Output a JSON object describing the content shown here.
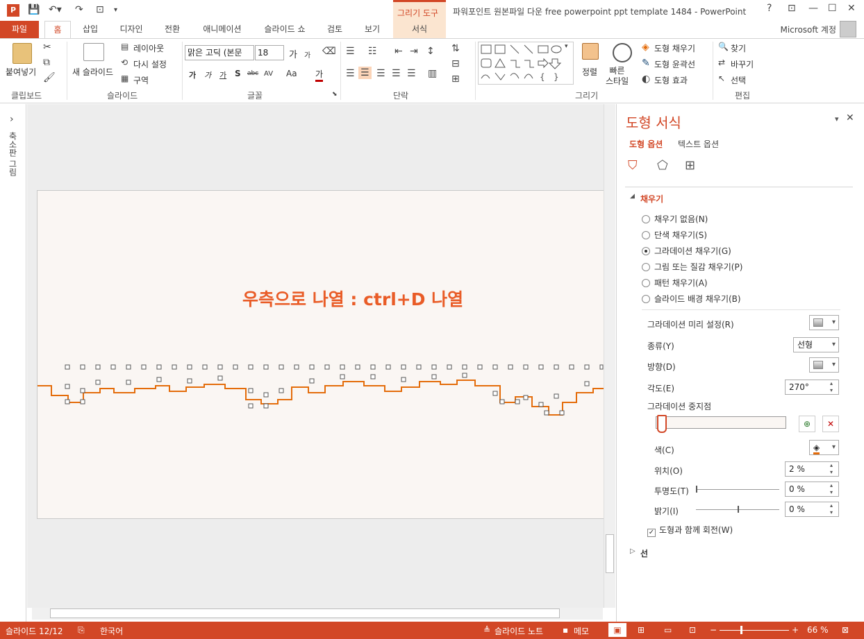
{
  "window": {
    "title": "파워포인트 원본파일 다운 free powerpoint ppt template 1484 - PowerPoint",
    "context_tab": "그리기 도구",
    "account": "Microsoft 계정",
    "help": "?",
    "min": "—",
    "max": "☐",
    "close": "✕"
  },
  "tabs": [
    "파일",
    "홈",
    "삽입",
    "디자인",
    "전환",
    "애니메이션",
    "슬라이드 쇼",
    "검토",
    "보기",
    "서식"
  ],
  "ribbon": {
    "clipboard": {
      "label": "클립보드",
      "paste": "붙여넣기"
    },
    "slides": {
      "label": "슬라이드",
      "new_slide": "새 슬라이드",
      "layout": "레이아웃",
      "reset": "다시 설정",
      "section": "구역"
    },
    "font": {
      "label": "글꼴",
      "font_name": "맑은 고딕 (본문",
      "font_size": "18",
      "grow": "가",
      "shrink": "가",
      "bold": "가",
      "italic": "가",
      "underline": "가",
      "shadow": "S",
      "strike": "abc",
      "spacing": "AV",
      "case": "Aa",
      "color": "가"
    },
    "paragraph": {
      "label": "단락"
    },
    "drawing": {
      "label": "그리기",
      "arrange": "정렬",
      "quick_styles": "빠른\n스타일",
      "shape_fill": "도형 채우기",
      "shape_outline": "도형 윤곽선",
      "shape_effects": "도형 효과"
    },
    "editing": {
      "label": "편집",
      "find": "찾기",
      "replace": "바꾸기",
      "select": "선택"
    }
  },
  "thumbnails": {
    "label": "축소판 그림"
  },
  "slide": {
    "title": "우측으로 나열 : ctrl+D 나열"
  },
  "pane": {
    "title": "도형 서식",
    "tab_shape": "도형 옵션",
    "tab_text": "텍스트 옵션",
    "fill_section": "채우기",
    "fill_options": [
      "채우기 없음(N)",
      "단색 채우기(S)",
      "그라데이션 채우기(G)",
      "그림 또는 질감 채우기(P)",
      "패턴 채우기(A)",
      "슬라이드 배경 채우기(B)"
    ],
    "selected_fill": 2,
    "preset_label": "그라데이션 미리 설정(R)",
    "type_label": "종류(Y)",
    "type_value": "선형",
    "direction_label": "방향(D)",
    "angle_label": "각도(E)",
    "angle_value": "270°",
    "stops_label": "그라데이션 중지점",
    "color_label": "색(C)",
    "position_label": "위치(O)",
    "position_value": "2 %",
    "transparency_label": "투명도(T)",
    "transparency_value": "0 %",
    "brightness_label": "밝기(I)",
    "brightness_value": "0 %",
    "rotate_label": "도형과 함께 회전(W)",
    "line_section": "선"
  },
  "status": {
    "slide": "슬라이드 12/12",
    "language": "한국어",
    "notes": "슬라이드 노트",
    "comments": "메모",
    "zoom": "66 %"
  },
  "colors": {
    "accent": "#d24726",
    "title": "#e95c27",
    "slide_bg": "#faf6f3"
  }
}
